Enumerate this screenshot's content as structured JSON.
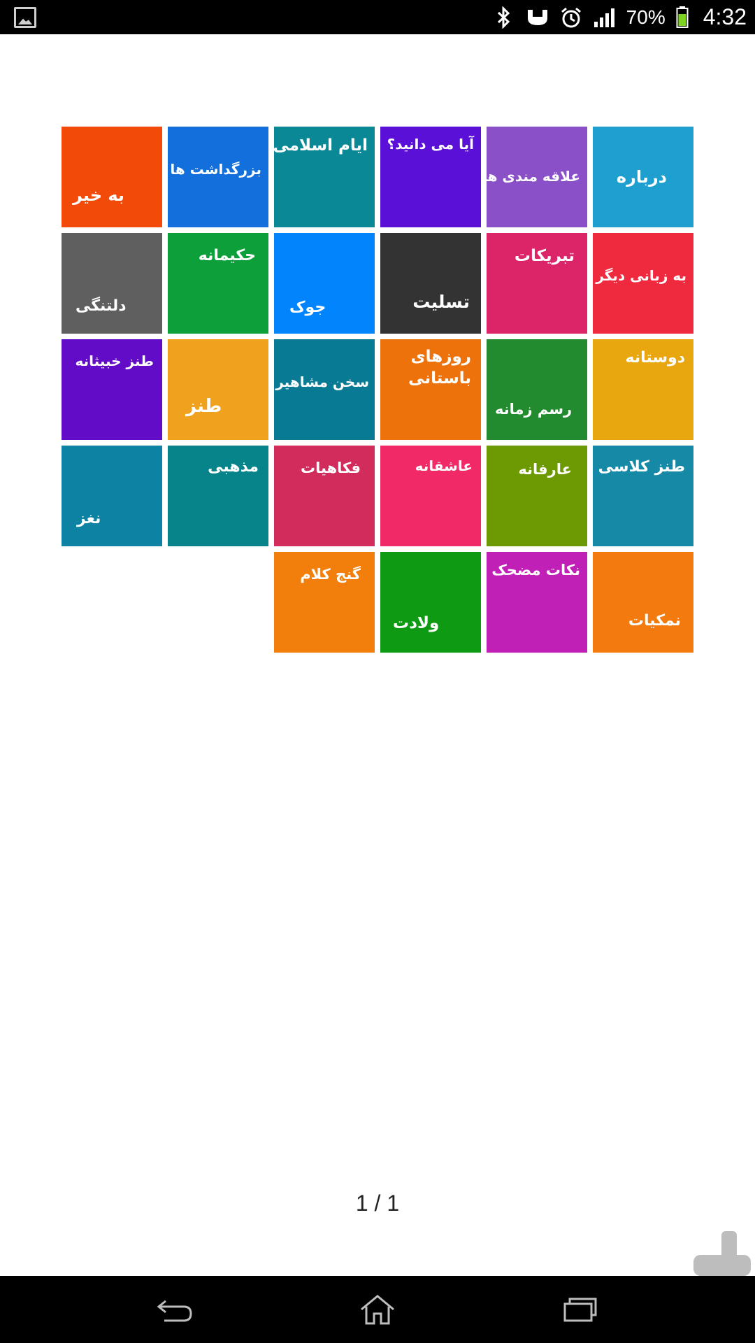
{
  "status_bar": {
    "battery_percent": "70%",
    "time": "4:32",
    "icons": [
      "image-icon",
      "bluetooth-icon",
      "android-icon",
      "alarm-icon",
      "signal-icon",
      "battery-icon"
    ]
  },
  "tiles": [
    {
      "label": "درباره",
      "color": "#1e9fd0"
    },
    {
      "label": "علاقه مندی ها",
      "color": "#8a50c8"
    },
    {
      "label": "آیا می دانید؟",
      "color": "#5b10d8"
    },
    {
      "label": "ایام اسلامی",
      "color": "#0a8896"
    },
    {
      "label": "بزرگداشت ها",
      "color": "#136fdc"
    },
    {
      "label": "به خیر",
      "color": "#f24a08"
    },
    {
      "label": "به زبانی دیگر",
      "color": "#ef2a3e"
    },
    {
      "label": "تبریکات",
      "color": "#dc2469"
    },
    {
      "label": "تسلیت",
      "color": "#333333"
    },
    {
      "label": "جوک",
      "color": "#0284fc"
    },
    {
      "label": "حکیمانه",
      "color": "#0d9f3a"
    },
    {
      "label": "دلتنگی",
      "color": "#5f5f5f"
    },
    {
      "label": "دوستانه",
      "color": "#e8a60f"
    },
    {
      "label": "رسم زمانه",
      "color": "#238b2f"
    },
    {
      "label": "روزهای باستانی",
      "color": "#ee720c"
    },
    {
      "label": "سخن مشاهیر",
      "color": "#087a94"
    },
    {
      "label": "طنز",
      "color": "#f0a21e"
    },
    {
      "label": "طنز خبیثانه",
      "color": "#620cc8"
    },
    {
      "label": "طنز کلاسی",
      "color": "#1689a6"
    },
    {
      "label": "عارفانه",
      "color": "#6d9a02"
    },
    {
      "label": "عاشقانه",
      "color": "#f12a67"
    },
    {
      "label": "فکاهیات",
      "color": "#d22c5c"
    },
    {
      "label": "مذهبی",
      "color": "#07848a"
    },
    {
      "label": "نغز",
      "color": "#0d82a2"
    },
    {
      "label": "نمکیات",
      "color": "#f27a0e"
    },
    {
      "label": "نکات مضحک",
      "color": "#c020b6"
    },
    {
      "label": "ولادت",
      "color": "#0e9a12"
    },
    {
      "label": "گنج کلام",
      "color": "#f27e0b"
    }
  ],
  "pager": {
    "text": "1 / 1"
  },
  "nav": {
    "back": "back-icon",
    "home": "home-icon",
    "recents": "recents-icon"
  }
}
